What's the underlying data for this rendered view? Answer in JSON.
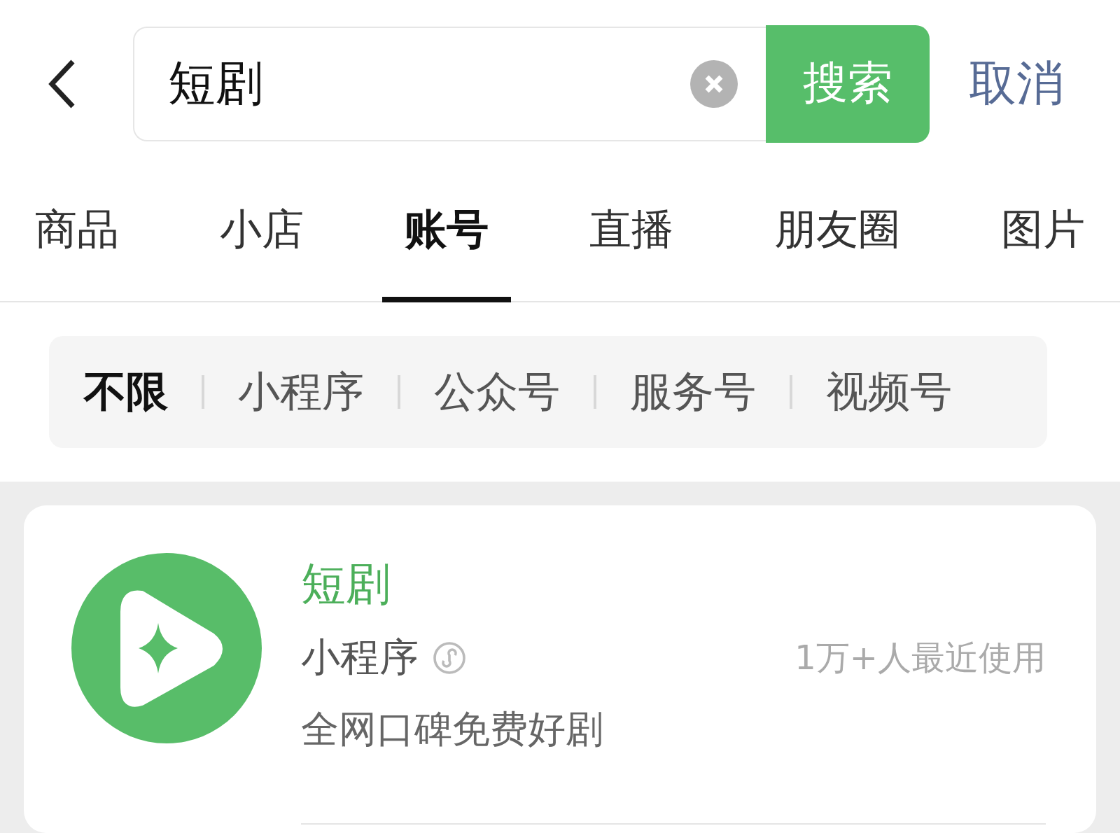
{
  "search": {
    "value": "短剧",
    "button": "搜索",
    "cancel": "取消"
  },
  "tabs": [
    {
      "label": "商品",
      "selected": false
    },
    {
      "label": "小店",
      "selected": false
    },
    {
      "label": "账号",
      "selected": true
    },
    {
      "label": "直播",
      "selected": false
    },
    {
      "label": "朋友圈",
      "selected": false
    },
    {
      "label": "图片",
      "selected": false
    }
  ],
  "filters": [
    {
      "label": "不限",
      "selected": true
    },
    {
      "label": "小程序",
      "selected": false
    },
    {
      "label": "公众号",
      "selected": false
    },
    {
      "label": "服务号",
      "selected": false
    },
    {
      "label": "视频号",
      "selected": false
    }
  ],
  "results": [
    {
      "title": "短剧",
      "type": "小程序",
      "usage": "1万+人最近使用",
      "description": "全网口碑免费好剧"
    }
  ]
}
